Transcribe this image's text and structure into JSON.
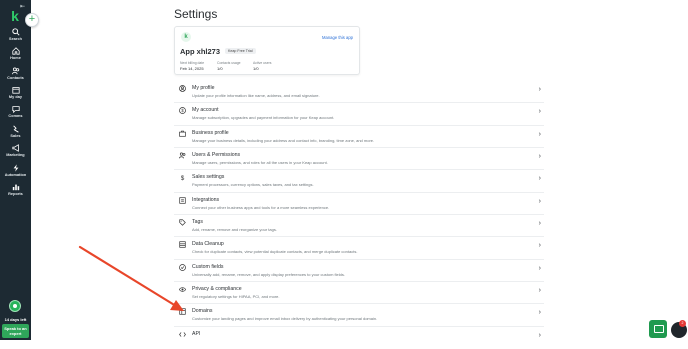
{
  "sidebar": {
    "logo": "k",
    "nav": [
      {
        "label": "Search",
        "icon": "search-icon"
      },
      {
        "label": "Home",
        "icon": "home-icon"
      },
      {
        "label": "Contacts",
        "icon": "contacts-icon"
      },
      {
        "label": "My day",
        "icon": "calendar-icon"
      },
      {
        "label": "Comms",
        "icon": "chat-icon"
      },
      {
        "label": "Sales",
        "icon": "sales-icon"
      },
      {
        "label": "Marketing",
        "icon": "megaphone-icon"
      },
      {
        "label": "Automation",
        "icon": "lightning-icon"
      },
      {
        "label": "Reports",
        "icon": "bar-chart-icon"
      }
    ],
    "trial": "14 days left",
    "expert_button": "Speak to an expert"
  },
  "page": {
    "title": "Settings"
  },
  "app_card": {
    "name": "App xhl273",
    "badge": "Keap Free Trial",
    "manage_link": "Manage this app",
    "meta": [
      {
        "label": "Next billing date",
        "value": "Feb 14, 2025"
      },
      {
        "label": "Contacts usage",
        "value": "1/0"
      },
      {
        "label": "Active users",
        "value": "1/0"
      }
    ]
  },
  "settings": [
    {
      "title": "My profile",
      "desc": "Update your profile information like name, address, and email signature.",
      "icon": "user-circle-icon"
    },
    {
      "title": "My account",
      "desc": "Manage subscription, upgrades and payment information for your Keap account.",
      "icon": "dollar-circle-icon"
    },
    {
      "title": "Business profile",
      "desc": "Manage your business details, including your address and contact info, branding, time zone, and more.",
      "icon": "briefcase-icon"
    },
    {
      "title": "Users & Permissions",
      "desc": "Manage users, permissions, and roles for all the users in your Keap account.",
      "icon": "users-icon"
    },
    {
      "title": "Sales settings",
      "desc": "Payment processors, currency options, sales taxes, and tax settings.",
      "icon": "dollar-icon"
    },
    {
      "title": "Integrations",
      "desc": "Connect your other business apps and tools for a more seamless experience.",
      "icon": "integrations-icon"
    },
    {
      "title": "Tags",
      "desc": "Add, rename, remove and reorganize your tags.",
      "icon": "tag-icon"
    },
    {
      "title": "Data Cleanup",
      "desc": "Check for duplicate contacts, view potential duplicate contacts, and merge duplicate contacts.",
      "icon": "database-icon"
    },
    {
      "title": "Custom fields",
      "desc": "Universally add, rename, remove, and apply display preferences to your custom fields.",
      "icon": "check-circle-icon"
    },
    {
      "title": "Privacy & compliance",
      "desc": "Set regulatory settings for HIPAA, PCI, and more.",
      "icon": "eye-icon"
    },
    {
      "title": "Domains",
      "desc": "Customize your landing pages and improve email inbox delivery by authenticating your personal domain.",
      "icon": "domain-icon"
    },
    {
      "title": "API",
      "desc": "",
      "icon": "code-icon"
    }
  ],
  "widget_badge": "2",
  "colors": {
    "sidebar": "#1d2a33",
    "brand": "#2fa65a",
    "annotation_arrow": "#e8462a",
    "link": "#2a6fd6"
  }
}
